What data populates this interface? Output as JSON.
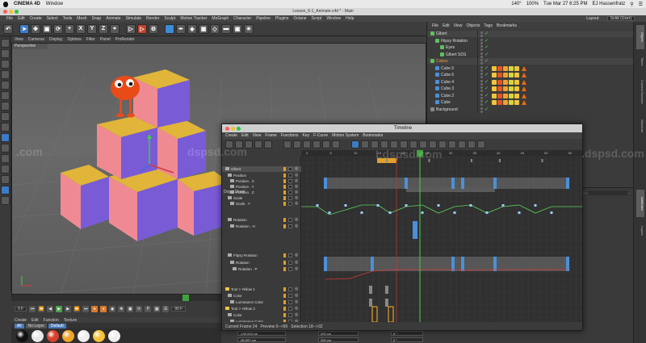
{
  "macbar": {
    "app": "CINEMA 4D",
    "window": "Window",
    "temp": "140°",
    "battery": "100%",
    "clock": "Tue Mar 27  6:25 PM",
    "user": "EJ Hassenfratz"
  },
  "app": {
    "title": "Lesson_6-1_Animate.c4d * - Main",
    "menu": [
      "File",
      "Edit",
      "Create",
      "Select",
      "Tools",
      "Mesh",
      "Snap",
      "Animate",
      "Simulate",
      "Render",
      "Sculpt",
      "Motion Tracker",
      "MoGraph",
      "Character",
      "Pipeline",
      "Plugins",
      "Octane",
      "Script",
      "Window",
      "Help"
    ],
    "layout_label": "Layout:",
    "layout_value": "Solid (User)"
  },
  "viewport": {
    "menu": [
      "View",
      "Cameras",
      "Display",
      "Options",
      "Filter",
      "Panel",
      "ProRender"
    ],
    "tab": "Perspective"
  },
  "playback": {
    "frame_field": "0 F",
    "end_field": "90 F"
  },
  "materials": {
    "menu": [
      "Create",
      "Edit",
      "Function",
      "Texture"
    ],
    "filters": [
      "All",
      "No Layer",
      "Default"
    ],
    "balls": [
      "#111111",
      "#e8e8e8",
      "#d7402a",
      "#f0a52a",
      "#eeeeee",
      "#f5c23a",
      "#efefef"
    ]
  },
  "objects": {
    "menu": [
      "File",
      "Edit",
      "View",
      "Objects",
      "Tags",
      "Bookmarks"
    ],
    "items": [
      {
        "name": "Glbert",
        "indent": 0
      },
      {
        "name": "Flipsy Rotation",
        "indent": 1
      },
      {
        "name": "Eyes",
        "indent": 2
      },
      {
        "name": "Glbert SDS",
        "indent": 2
      },
      {
        "name": "Cubes",
        "indent": 0
      },
      {
        "name": "Cube.5",
        "indent": 1
      },
      {
        "name": "Cube.6",
        "indent": 1
      },
      {
        "name": "Cube.4",
        "indent": 1
      },
      {
        "name": "Cube.3",
        "indent": 1
      },
      {
        "name": "Cube.2",
        "indent": 1
      },
      {
        "name": "Cube",
        "indent": 1
      },
      {
        "name": "Background",
        "indent": 0
      }
    ]
  },
  "right_tabs": [
    "Object",
    "Takes",
    "Content Browser",
    "Structure",
    "Attributes",
    "Layers"
  ],
  "timeline": {
    "title": "Timeline",
    "menu": [
      "Create",
      "Edit",
      "View",
      "Frame",
      "Functions",
      "Key",
      "F-Curve",
      "Motion System",
      "Bookmarks"
    ],
    "mode": "Dope Sheet",
    "ruler": [
      "0",
      "5",
      "10",
      "15",
      "20",
      "25",
      "30",
      "35",
      "40",
      "45",
      "50",
      "55"
    ],
    "tracks": [
      "Glbert",
      "Position",
      "Position . X",
      "Position . Y",
      "Position . Z",
      "Scale",
      "Scale . Y",
      "Rotation",
      "Rotation . H",
      "Flipsy Rotation",
      "Rotation",
      "Rotation . P",
      "Tool > Yellow 1",
      "Color",
      "Luminance Color",
      "Tool > Yellow 2",
      "Color",
      "Luminance Color"
    ],
    "status": {
      "current_frame": "Current Frame  24",
      "preview": "Preview  0-->90",
      "selection": "Selection  18-->32"
    }
  },
  "coords": {
    "x": "-135.533 cm",
    "y": "-55.997 cm",
    "sx": "200 cm",
    "sy": "200 cm",
    "h": "0 °",
    "p": "0 °"
  },
  "watermarks": {
    "left": ".com",
    "center": "Ldspsd.com",
    "right": ".dspsd.com",
    "mid": "dspsd.com"
  }
}
